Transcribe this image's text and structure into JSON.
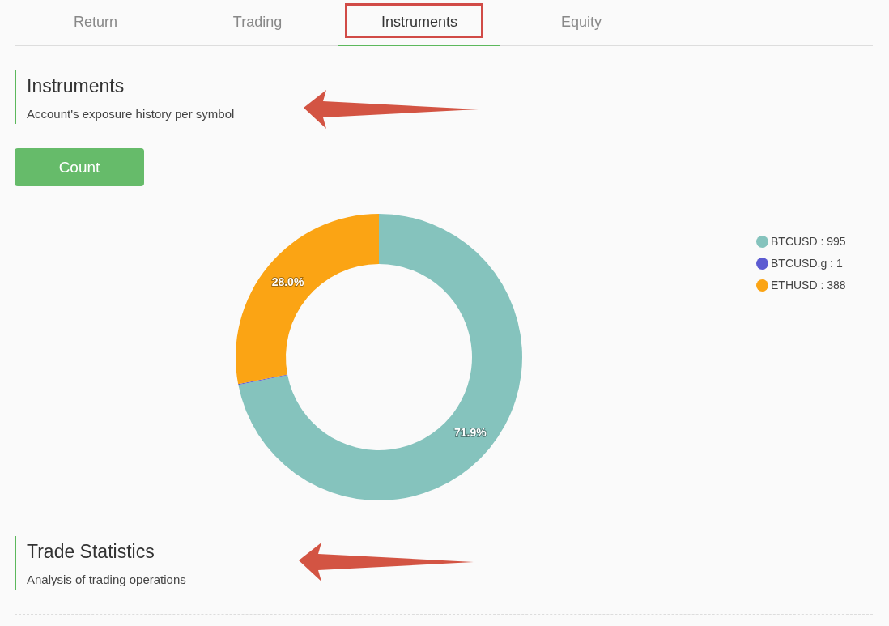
{
  "tabs": [
    {
      "label": "Return",
      "selected": false,
      "outlined": false
    },
    {
      "label": "Trading",
      "selected": false,
      "outlined": false
    },
    {
      "label": "Instruments",
      "selected": true,
      "outlined": true
    },
    {
      "label": "Equity",
      "selected": false,
      "outlined": false
    }
  ],
  "sections": [
    {
      "title": "Instruments",
      "subtitle": "Account's exposure history per symbol",
      "arrow": true
    },
    {
      "title": "Trade Statistics",
      "subtitle": "Analysis of trading operations",
      "arrow": true
    }
  ],
  "count_button": {
    "label": "Count"
  },
  "chart_data": {
    "type": "donut",
    "categories": [
      "BTCUSD : 995",
      "BTCUSD.g : 1",
      "ETHUSD : 388"
    ],
    "series": [
      {
        "values": [
          71.9,
          0.1,
          28.0
        ]
      }
    ],
    "colors": [
      "#85c3bd",
      "#5c5bd1",
      "#fba414"
    ],
    "value_labels": [
      "71.9%",
      null,
      "28.0%"
    ]
  }
}
